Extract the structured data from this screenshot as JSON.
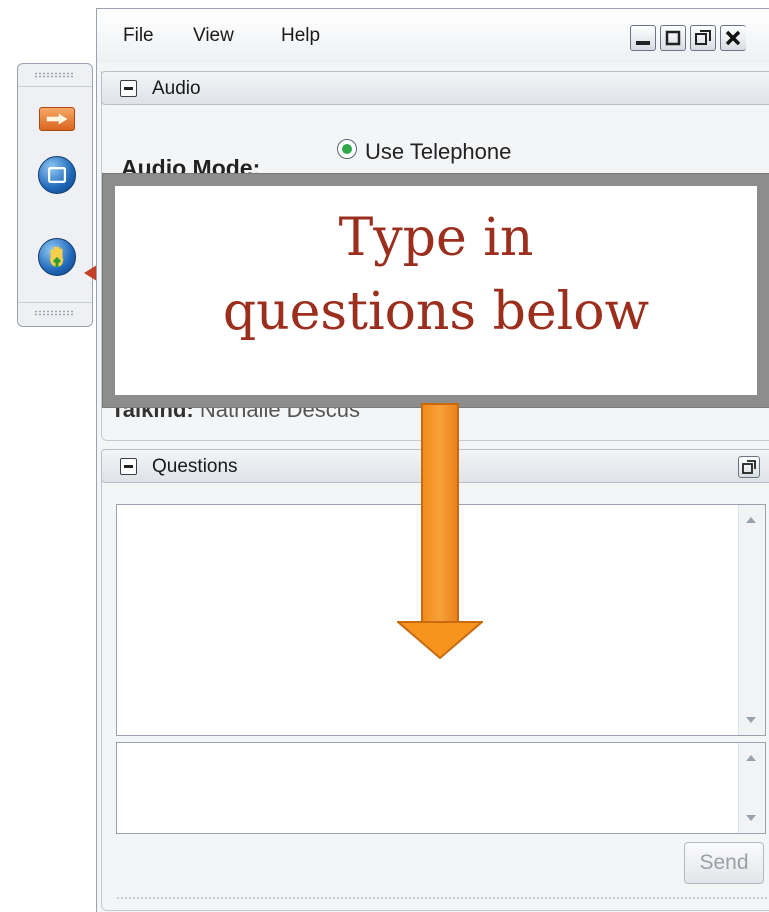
{
  "menu": {
    "items": [
      "File",
      "View",
      "Help"
    ]
  },
  "window_controls": [
    "minimize-icon",
    "restore-icon",
    "maximize-icon",
    "close-icon"
  ],
  "audio": {
    "title": "Audio",
    "mode_label": "Audio Mode:",
    "option_selected": "Use Telephone",
    "talking_label": "Talking:",
    "talking_name": "Nathalie Descus"
  },
  "questions": {
    "title": "Questions",
    "send_label": "Send"
  },
  "callout": {
    "line1": "Type in",
    "line2": "questions below"
  },
  "colors": {
    "callout_text": "#9b2e1c",
    "arrow": "#f7941d",
    "radio_selected": "#2fa84a"
  }
}
